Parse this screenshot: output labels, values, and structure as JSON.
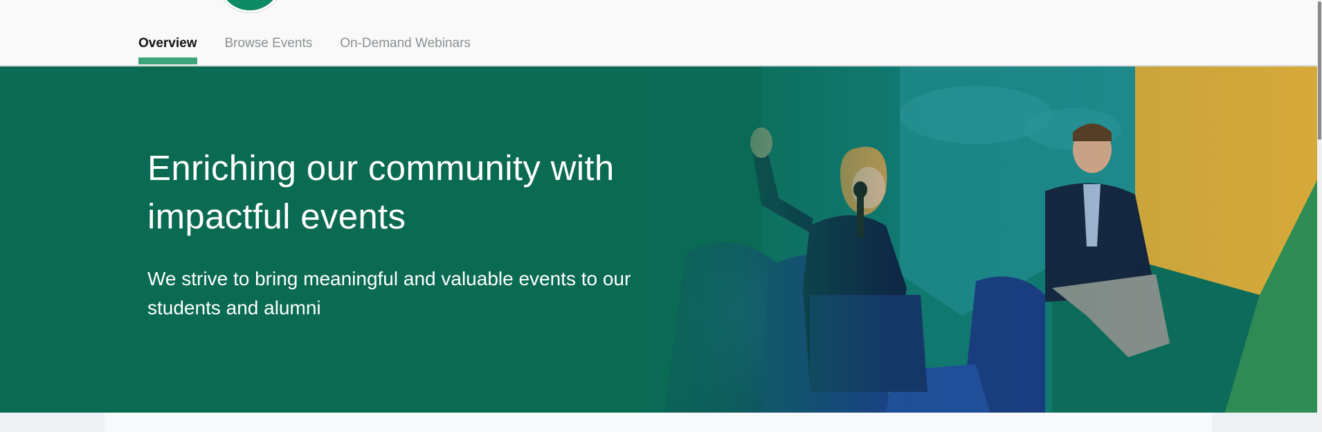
{
  "nav": {
    "tabs": [
      {
        "label": "Overview",
        "active": true
      },
      {
        "label": "Browse Events",
        "active": false
      },
      {
        "label": "On-Demand Webinars",
        "active": false
      }
    ]
  },
  "hero": {
    "title_line1": "Enriching our community with",
    "title_line2": "impactful events",
    "subtitle_line1": "We strive to bring meaningful and valuable events to our",
    "subtitle_line2": "students and alumni"
  },
  "colors": {
    "hero_background": "#0a6a52",
    "active_tab_underline": "#3ea57a",
    "logo": "#0d8a64"
  }
}
